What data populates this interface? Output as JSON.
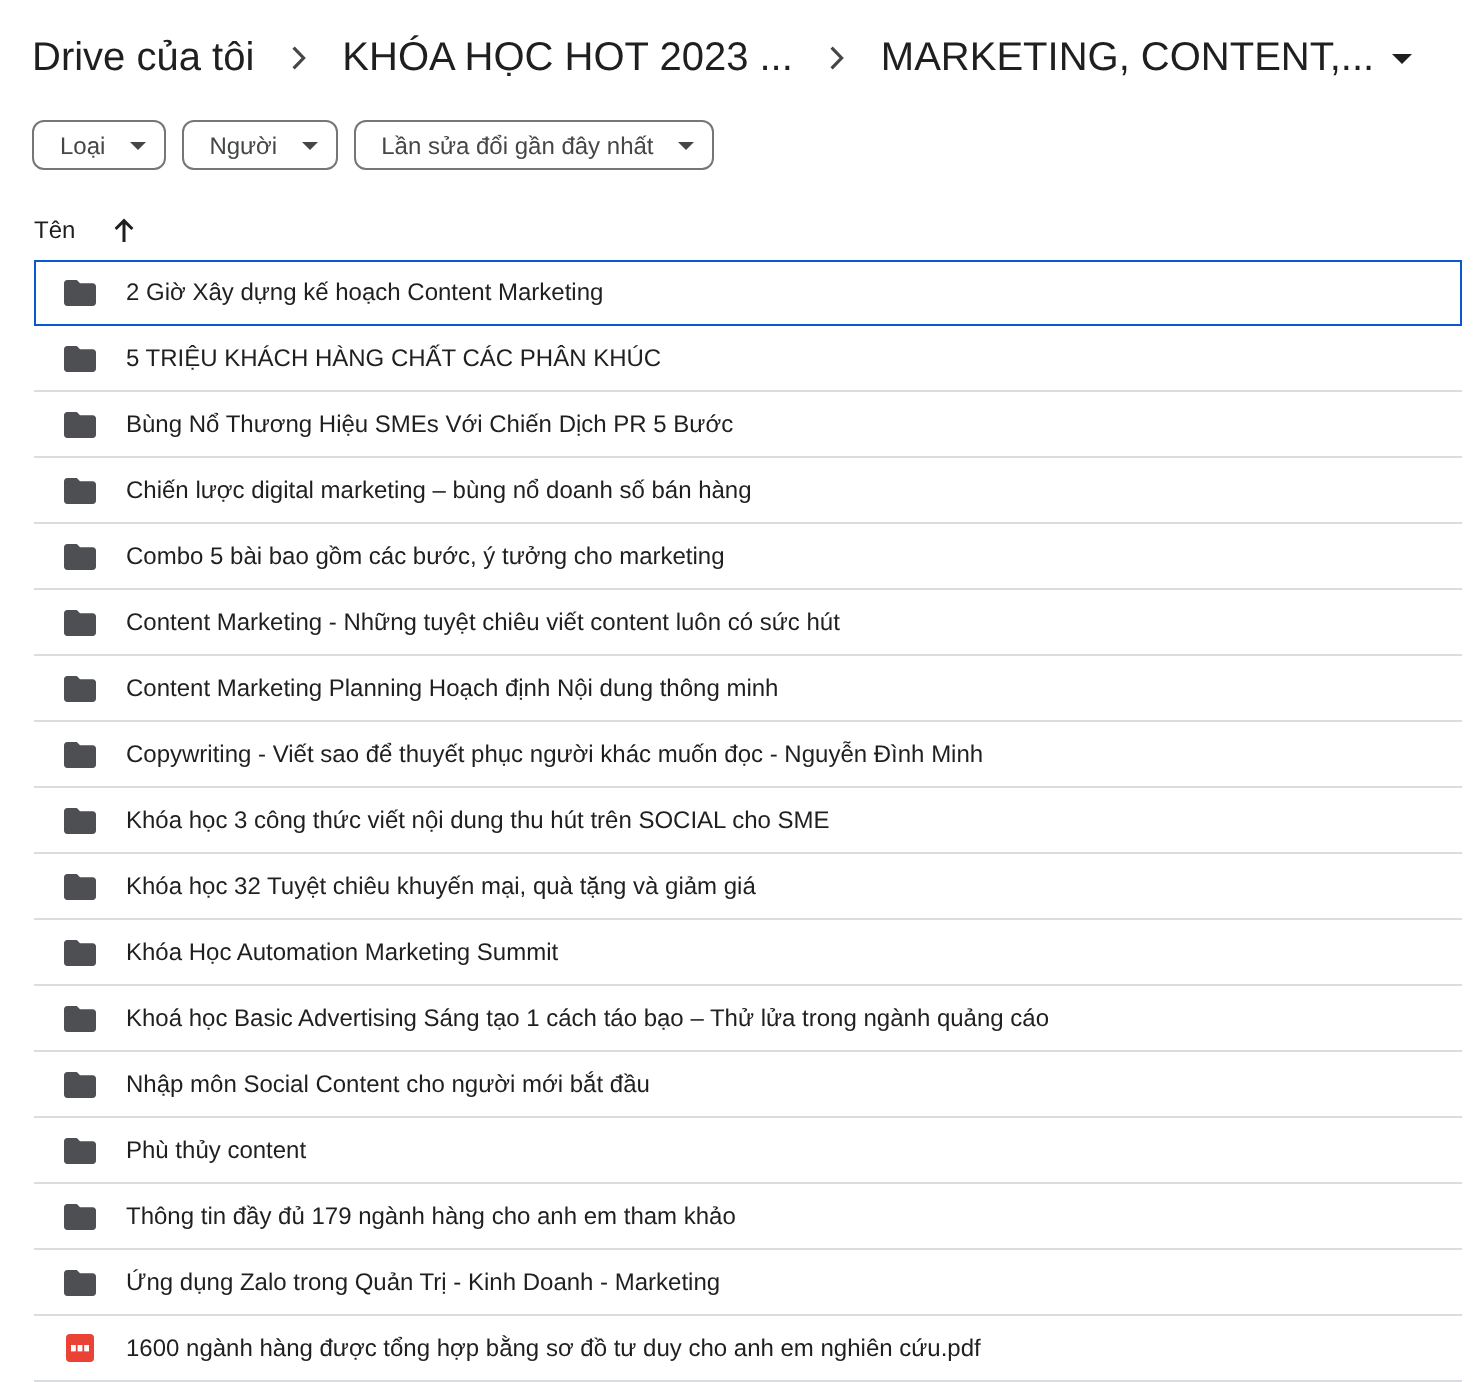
{
  "breadcrumb": [
    {
      "label": "Drive của tôi",
      "menu": false
    },
    {
      "label": "KHÓA HỌC HOT 2023 ...",
      "menu": false
    },
    {
      "label": "MARKETING, CONTENT,...",
      "menu": true
    }
  ],
  "filters": [
    {
      "label": "Loại"
    },
    {
      "label": "Người"
    },
    {
      "label": "Lần sửa đổi gần đây nhất"
    }
  ],
  "list_header": {
    "label": "Tên",
    "sorted_ascending": true
  },
  "items": [
    {
      "kind": "folder",
      "name": "2 Giờ Xây dựng kế hoạch Content Marketing",
      "focused": true
    },
    {
      "kind": "folder",
      "name": "5 TRIỆU KHÁCH HÀNG CHẤT CÁC PHÂN KHÚC",
      "focused": false
    },
    {
      "kind": "folder",
      "name": "Bùng Nổ Thương Hiệu SMEs Với Chiến Dịch PR 5 Bước",
      "focused": false
    },
    {
      "kind": "folder",
      "name": "Chiến lược digital marketing – bùng nổ doanh số bán hàng",
      "focused": false
    },
    {
      "kind": "folder",
      "name": "Combo 5 bài bao gồm các bước, ý tưởng cho marketing",
      "focused": false
    },
    {
      "kind": "folder",
      "name": "Content Marketing - Những tuyệt chiêu viết content luôn có sức hút",
      "focused": false
    },
    {
      "kind": "folder",
      "name": "Content Marketing Planning Hoạch định Nội dung thông minh",
      "focused": false
    },
    {
      "kind": "folder",
      "name": "Copywriting - Viết sao để thuyết phục người khác muốn đọc - Nguyễn Đình Minh",
      "focused": false
    },
    {
      "kind": "folder",
      "name": "Khóa học 3 công thức viết nội dung thu hút trên SOCIAL cho SME",
      "focused": false
    },
    {
      "kind": "folder",
      "name": "Khóa học 32 Tuyệt chiêu khuyến mại, quà tặng và giảm giá",
      "focused": false
    },
    {
      "kind": "folder",
      "name": "Khóa Học Automation Marketing Summit",
      "focused": false
    },
    {
      "kind": "folder",
      "name": "Khoá học Basic Advertising Sáng tạo 1 cách táo bạo – Thử lửa trong ngành quảng cáo",
      "focused": false
    },
    {
      "kind": "folder",
      "name": "Nhập môn Social Content cho người mới bắt đầu",
      "focused": false
    },
    {
      "kind": "folder",
      "name": "Phù thủy content",
      "focused": false
    },
    {
      "kind": "folder",
      "name": "Thông tin đầy đủ 179 ngành hàng cho anh em tham khảo",
      "focused": false
    },
    {
      "kind": "folder",
      "name": "Ứng dụng Zalo trong Quản Trị - Kinh Doanh - Marketing",
      "focused": false
    },
    {
      "kind": "pdf",
      "name": "1600 ngành hàng được tổng hợp bằng sơ đồ tư duy cho anh em nghiên cứu.pdf",
      "focused": false
    }
  ]
}
